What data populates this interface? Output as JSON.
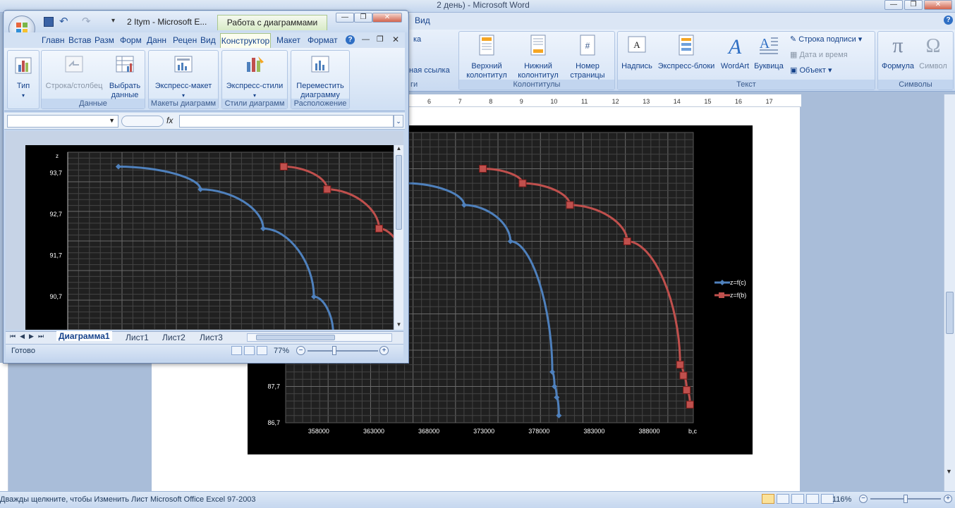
{
  "word": {
    "title": "2 день) - Microsoft Word",
    "visible_tab": "Вид",
    "groups": {
      "colontituly": {
        "label": "Колонтитулы",
        "buttons": [
          "Верхний\nколонтитул",
          "Нижний\nколонтитул",
          "Номер\nстраницы"
        ]
      },
      "text": {
        "label": "Текст",
        "buttons": [
          "Надпись",
          "Экспресс-блоки",
          "WordArt",
          "Буквица"
        ],
        "small": [
          "Строка подписи",
          "Дата и время",
          "Объект"
        ]
      },
      "symbols": {
        "label": "Символы",
        "buttons": [
          "Формула",
          "Символ"
        ]
      }
    },
    "partial": {
      "top": "ка",
      "link": "ная ссылка",
      "bottom": "ги"
    },
    "ruler": [
      "6",
      "7",
      "8",
      "9",
      "10",
      "11",
      "12",
      "13",
      "14",
      "15",
      "16",
      "17"
    ],
    "status": "Дважды щелкните, чтобы Изменить Лист Microsoft Office Excel 97-2003",
    "zoom": "116%"
  },
  "excel": {
    "title": "2 Itym - Microsoft E...",
    "context_tab": "Работа с диаграммами",
    "tabs": [
      "Главн",
      "Встав",
      "Разм",
      "Форм",
      "Данн",
      "Рецен",
      "Вид"
    ],
    "active_tab": "Конструктор",
    "other_tabs": [
      "Макет",
      "Формат"
    ],
    "groups": {
      "type": {
        "label": "",
        "buttons": [
          "Тип"
        ]
      },
      "data": {
        "label": "Данные",
        "buttons": [
          "Строка/столбец",
          "Выбрать\nданные"
        ]
      },
      "layouts": {
        "label": "Макеты диаграмм",
        "buttons": [
          "Экспресс-макет"
        ]
      },
      "styles": {
        "label": "Стили диаграмм",
        "buttons": [
          "Экспресс-стили"
        ]
      },
      "location": {
        "label": "Расположение",
        "buttons": [
          "Переместить\nдиаграмму"
        ]
      }
    },
    "fx": "fx",
    "sheet_tabs": [
      "Диаграмма1",
      "Лист1",
      "Лист2",
      "Лист3"
    ],
    "status": "Готово",
    "zoom": "77%"
  },
  "chart_data": [
    {
      "type": "line",
      "title": "",
      "xlabel": "b,c",
      "ylabel": "",
      "xlim": [
        355000,
        392000
      ],
      "ylim": [
        86.7,
        94.7
      ],
      "x_ticks": [
        "358000",
        "363000",
        "368000",
        "373000",
        "378000",
        "383000",
        "388000"
      ],
      "y_ticks": [
        "86,7",
        "87,7"
      ],
      "grid": true,
      "legend": "right",
      "series": [
        {
          "name": "z=f(c)",
          "color": "#4f81bd",
          "x": [
            359200,
            366000,
            371200,
            375400,
            379200,
            379400,
            379600,
            379800
          ],
          "y": [
            93.7,
            93.3,
            92.7,
            91.7,
            88.1,
            87.7,
            87.4,
            86.9
          ]
        },
        {
          "name": "z=f(b)",
          "color": "#c0504d",
          "x": [
            372900,
            376500,
            380800,
            386000,
            390800,
            391100,
            391400,
            391700
          ],
          "y": [
            93.7,
            93.3,
            92.7,
            91.7,
            88.3,
            88.0,
            87.6,
            87.2
          ]
        }
      ]
    },
    {
      "type": "line",
      "title": "",
      "xlabel": "",
      "ylabel": "z",
      "xlim": [
        355000,
        382000
      ],
      "ylim": [
        89.9,
        94.2
      ],
      "y_ticks": [
        "93,7",
        "92,7",
        "91,7",
        "90,7"
      ],
      "grid": true,
      "series": [
        {
          "name": "z=f(c)",
          "color": "#4f81bd",
          "x": [
            359200,
            366000,
            371200,
            375400,
            377000
          ],
          "y": [
            93.85,
            93.3,
            92.35,
            90.7,
            89.8
          ]
        },
        {
          "name": "z=f(b)",
          "color": "#c0504d",
          "x": [
            372900,
            376500,
            380800,
            383000
          ],
          "y": [
            93.85,
            93.3,
            92.35,
            91.3
          ]
        }
      ]
    }
  ]
}
